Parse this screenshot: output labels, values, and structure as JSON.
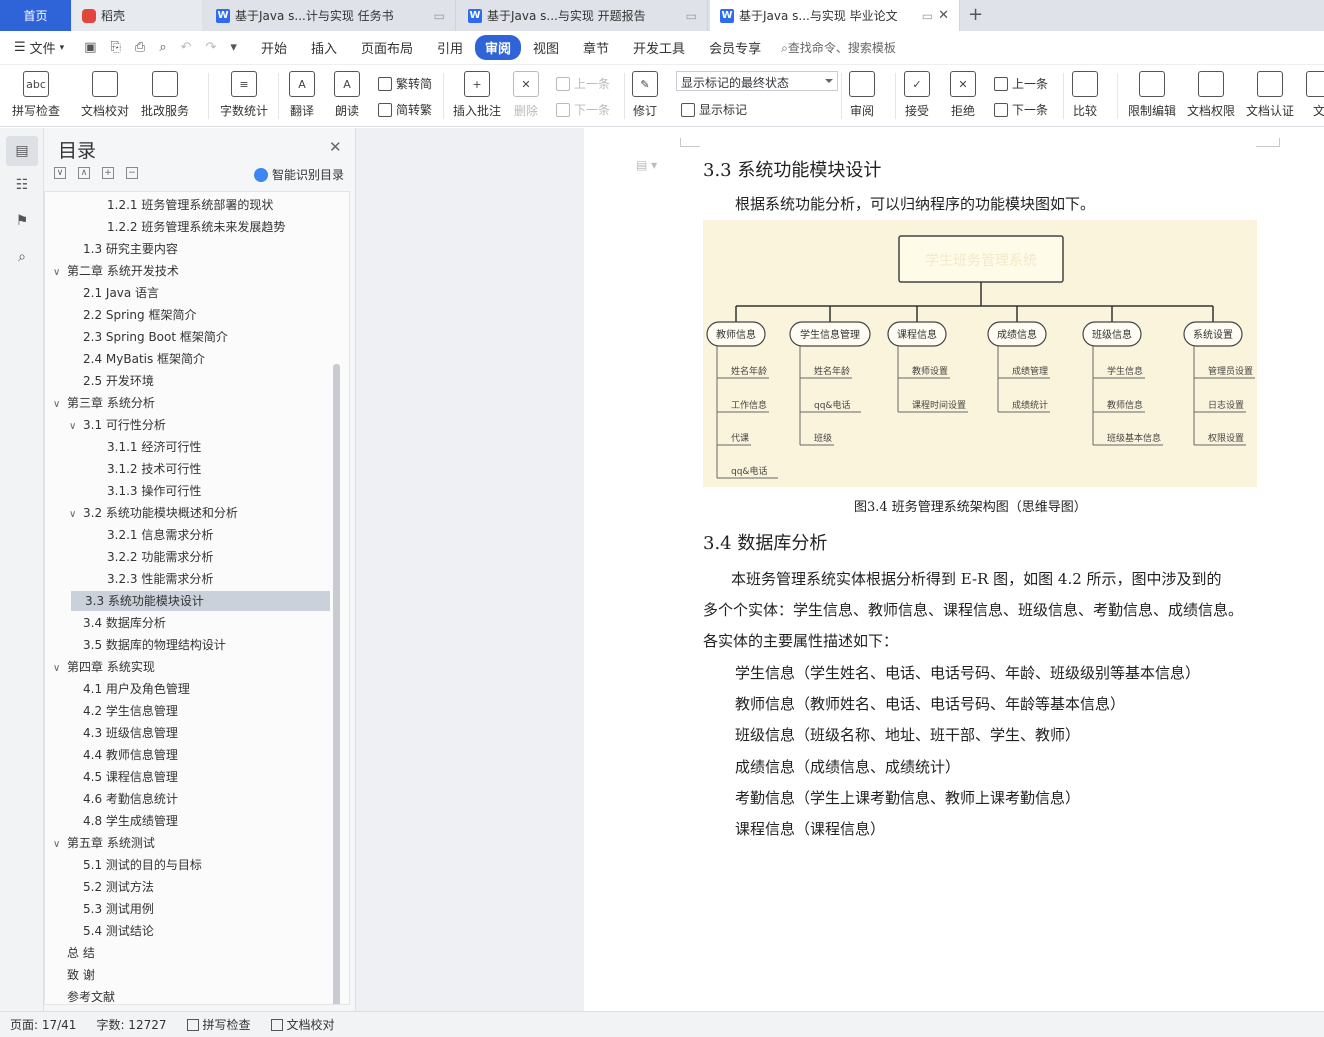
{
  "tabs": {
    "home": "首页",
    "daoke": "稻壳",
    "doc1": "基于Java s...计与实现 任务书",
    "doc2": "基于Java s...与实现 开题报告",
    "doc3": "基于Java s...与实现 毕业论文",
    "add": "+"
  },
  "menu": {
    "file": "文件",
    "items": [
      "开始",
      "插入",
      "页面布局",
      "引用",
      "审阅",
      "视图",
      "章节",
      "开发工具",
      "会员专享"
    ],
    "active": "审阅",
    "search": "查找命令、搜索模板"
  },
  "ribbon": {
    "spellcheck": "拼写检查",
    "doc_proof": "文档校对",
    "batch": "批改服务",
    "wordcount": "字数统计",
    "translate": "翻译",
    "read": "朗读",
    "to_trad": "繁转简",
    "to_simp": "简转繁",
    "insert_comment": "插入批注",
    "delete": "删除",
    "prev": "上一条",
    "next": "下一条",
    "revise": "修订",
    "track_state": "显示标记的最终状态",
    "show_marks": "显示标记",
    "review": "审阅",
    "accept": "接受",
    "reject": "拒绝",
    "prev2": "上一条",
    "next2": "下一条",
    "compare": "比较",
    "restrict": "限制编辑",
    "doc_rights": "文档权限",
    "doc_cert": "文档认证",
    "more": "文"
  },
  "toc": {
    "title": "目录",
    "smart": "智能识别目录",
    "items": [
      {
        "label": "1.2.1  班务管理系统部署的现状",
        "level": 3
      },
      {
        "label": "1.2.2  班务管理系统未来发展趋势",
        "level": 3
      },
      {
        "label": "1.3  研究主要内容",
        "level": 2
      },
      {
        "label": "第二章  系统开发技术",
        "level": 1,
        "expand": true
      },
      {
        "label": "2.1 Java 语言",
        "level": 2
      },
      {
        "label": "2.2 Spring 框架简介",
        "level": 2
      },
      {
        "label": "2.3 Spring Boot 框架简介",
        "level": 2
      },
      {
        "label": "2.4 MyBatis  框架简介",
        "level": 2
      },
      {
        "label": "2.5  开发环境",
        "level": 2
      },
      {
        "label": "第三章  系统分析",
        "level": 1,
        "expand": true
      },
      {
        "label": "3.1  可行性分析",
        "level": 2,
        "expand": true
      },
      {
        "label": "3.1.1  经济可行性",
        "level": 3
      },
      {
        "label": "3.1.2  技术可行性",
        "level": 3
      },
      {
        "label": "3.1.3  操作可行性",
        "level": 3
      },
      {
        "label": "3.2  系统功能模块概述和分析",
        "level": 2,
        "expand": true
      },
      {
        "label": "3.2.1  信息需求分析",
        "level": 3
      },
      {
        "label": "3.2.2  功能需求分析",
        "level": 3
      },
      {
        "label": "3.2.3  性能需求分析",
        "level": 3
      },
      {
        "label": "3.3  系统功能模块设计",
        "level": 2,
        "selected": true
      },
      {
        "label": "3.4  数据库分析",
        "level": 2
      },
      {
        "label": "3.5  数据库的物理结构设计",
        "level": 2
      },
      {
        "label": "第四章  系统实现",
        "level": 1,
        "expand": true
      },
      {
        "label": "4.1  用户及角色管理",
        "level": 2
      },
      {
        "label": "4.2  学生信息管理",
        "level": 2
      },
      {
        "label": "4.3  班级信息管理",
        "level": 2
      },
      {
        "label": "4.4  教师信息管理",
        "level": 2
      },
      {
        "label": "4.5  课程信息管理",
        "level": 2
      },
      {
        "label": "4.6  考勤信息统计",
        "level": 2
      },
      {
        "label": "4.8  学生成绩管理",
        "level": 2
      },
      {
        "label": "第五章  系统测试",
        "level": 1,
        "expand": true
      },
      {
        "label": "5.1  测试的目的与目标",
        "level": 2
      },
      {
        "label": "5.2  测试方法",
        "level": 2
      },
      {
        "label": "5.3  测试用例",
        "level": 2
      },
      {
        "label": "5.4  测试结论",
        "level": 2
      },
      {
        "label": "总      结",
        "level": 1
      },
      {
        "label": "致      谢",
        "level": 1
      },
      {
        "label": "参考文献",
        "level": 1
      }
    ]
  },
  "doc": {
    "h_33": "3.3  系统功能模块设计",
    "p_33": "根据系统功能分析，可以归纳程序的功能模块图如下。",
    "mindmap": {
      "root": "学生班务管理系统",
      "branches": [
        {
          "name": "教师信息",
          "children": [
            "姓名年龄",
            "工作信息",
            "代课",
            "qq&电话"
          ]
        },
        {
          "name": "学生信息管理",
          "children": [
            "姓名年龄",
            "qq&电话",
            "班级"
          ]
        },
        {
          "name": "课程信息",
          "children": [
            "教师设置",
            "课程时间设置"
          ]
        },
        {
          "name": "成绩信息",
          "children": [
            "成绩管理",
            "成绩统计"
          ]
        },
        {
          "name": "班级信息",
          "children": [
            "学生信息",
            "教师信息",
            "班级基本信息"
          ]
        },
        {
          "name": "系统设置",
          "children": [
            "管理员设置",
            "日志设置",
            "权限设置"
          ]
        }
      ]
    },
    "caption": "图3.4  班务管理系统架构图（思维导图）",
    "h_34": "3.4  数据库分析",
    "p1_line1": "本班务管理系统实体根据分析得到 E-R 图，如图  4.2  所示，图中涉及到的",
    "p1_line2": "多个个实体：学生信息、教师信息、课程信息、班级信息、考勤信息、成绩信息。",
    "p1_line3": "各实体的主要属性描述如下：",
    "list": [
      "学生信息（学生姓名、电话、电话号码、年龄、班级级别等基本信息）",
      "教师信息（教师姓名、电话、电话号码、年龄等基本信息）",
      "班级信息（班级名称、地址、班干部、学生、教师）",
      "成绩信息（成绩信息、成绩统计）",
      "考勤信息（学生上课考勤信息、教师上课考勤信息）",
      "课程信息（课程信息）"
    ]
  },
  "status": {
    "page": "页面: 17/41",
    "words": "字数: 12727",
    "spell": "拼写检查",
    "proof": "文档校对"
  },
  "colors": {
    "accent": "#2f64d8",
    "figure_bg": "#fbf4dd"
  }
}
